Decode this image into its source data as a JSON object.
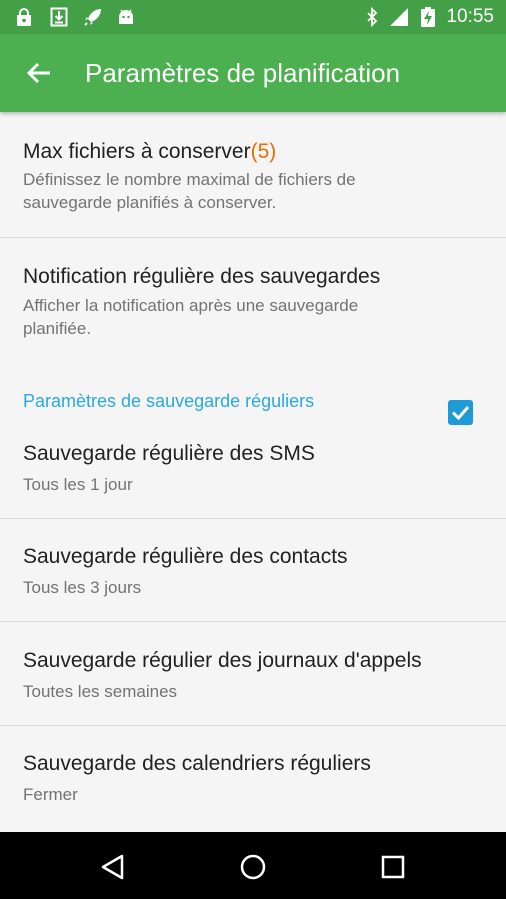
{
  "status_bar": {
    "time": "10:55",
    "left_icons": [
      "lock-icon",
      "download-icon",
      "rocket-icon",
      "android-icon"
    ],
    "right_icons": [
      "bluetooth-icon",
      "signal-icon",
      "battery-charging-icon"
    ]
  },
  "app_bar": {
    "title": "Paramètres de planification",
    "back_icon": "arrow-back-icon",
    "color": "#4caf50"
  },
  "settings": {
    "max_files": {
      "title": "Max fichiers à conserver",
      "value": "(5)",
      "subtitle": "Définissez le nombre maximal de fichiers de sauvegarde planifiés à conserver."
    },
    "notification": {
      "title": "Notification régulière des sauvegardes",
      "subtitle": "Afficher la notification après une sauvegarde planifiée.",
      "checked": true
    },
    "section_header": "Paramètres de sauvegarde réguliers",
    "items": [
      {
        "title": "Sauvegarde régulière des SMS",
        "subtitle": "Tous les 1 jour"
      },
      {
        "title": "Sauvegarde régulière des contacts",
        "subtitle": "Tous les 3 jours"
      },
      {
        "title": "Sauvegarde régulier des journaux d'appels",
        "subtitle": "Toutes les semaines"
      },
      {
        "title": "Sauvegarde des calendriers réguliers",
        "subtitle": "Fermer"
      }
    ]
  },
  "nav_bar": {
    "buttons": [
      "back-triangle-icon",
      "home-circle-icon",
      "recents-square-icon"
    ]
  },
  "colors": {
    "accent_orange": "#ef6c00",
    "section_blue": "#29a9e1",
    "checkbox_blue": "#1e9ad6"
  }
}
